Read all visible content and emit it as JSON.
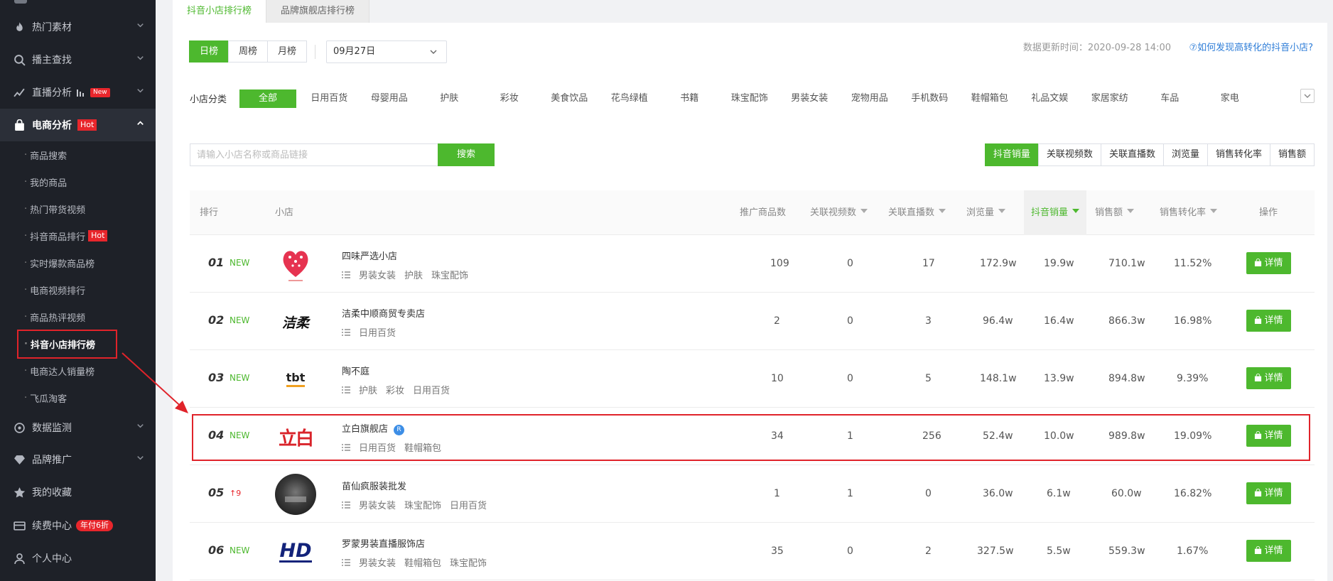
{
  "sidebar": {
    "items": [
      {
        "label": "热门素材",
        "icon": "fire-icon"
      },
      {
        "label": "播主查找",
        "icon": "search-icon"
      },
      {
        "label": "直播分析",
        "icon": "live-analysis-icon",
        "badge": "New"
      },
      {
        "label": "电商分析",
        "icon": "bag-icon",
        "badge": "Hot",
        "expanded": true
      },
      {
        "label": "数据监测",
        "icon": "monitor-icon"
      },
      {
        "label": "品牌推广",
        "icon": "diamond-icon"
      },
      {
        "label": "我的收藏",
        "icon": "star-icon"
      },
      {
        "label": "续费中心",
        "icon": "card-icon",
        "badge": "年付6折"
      },
      {
        "label": "个人中心",
        "icon": "user-icon"
      }
    ],
    "subitems": [
      {
        "label": "商品搜索"
      },
      {
        "label": "我的商品"
      },
      {
        "label": "热门带货视频"
      },
      {
        "label": "抖音商品排行",
        "badge": "Hot"
      },
      {
        "label": "实时爆款商品榜"
      },
      {
        "label": "电商视频排行"
      },
      {
        "label": "商品热评视频"
      },
      {
        "label": "抖音小店排行榜",
        "active": true
      },
      {
        "label": "电商达人销量榜"
      },
      {
        "label": "飞瓜淘客"
      }
    ]
  },
  "tabs": [
    {
      "label": "抖音小店排行榜",
      "active": true
    },
    {
      "label": "品牌旗舰店排行榜",
      "active": false
    }
  ],
  "period": {
    "options": [
      "日榜",
      "周榜",
      "月榜"
    ],
    "selected": "日榜",
    "date": "09月27日"
  },
  "update_text": "数据更新时间：2020-09-28 14:00",
  "help_link": "⑦如何发现高转化的抖音小店?",
  "category": {
    "label": "小店分类",
    "options": [
      "全部",
      "日用百货",
      "母婴用品",
      "护肤",
      "彩妆",
      "美食饮品",
      "花鸟绿植",
      "书籍",
      "珠宝配饰",
      "男装女装",
      "宠物用品",
      "手机数码",
      "鞋帽箱包",
      "礼品文娱",
      "家居家纺",
      "车品",
      "家电"
    ],
    "selected": "全部"
  },
  "search": {
    "placeholder": "请输入小店名称或商品链接",
    "button": "搜索"
  },
  "metrics": {
    "options": [
      "抖音销量",
      "关联视频数",
      "关联直播数",
      "浏览量",
      "销售转化率",
      "销售额"
    ],
    "selected": "抖音销量"
  },
  "table": {
    "headers": {
      "rank": "排行",
      "shop": "小店",
      "products": "推广商品数",
      "videos": "关联视频数",
      "lives": "关联直播数",
      "views": "浏览量",
      "sales": "抖音销量",
      "revenue": "销售额",
      "conversion": "销售转化率",
      "action": "操作"
    },
    "sorted_by": "抖音销量",
    "detail_label": "详情",
    "rows": [
      {
        "rank": "01",
        "change": "NEW",
        "name": "四味严选小店",
        "logo": "heart-logo",
        "cats": [
          "男装女装",
          "护肤",
          "珠宝配饰"
        ],
        "products": "109",
        "videos": "0",
        "lives": "17",
        "views": "172.9w",
        "sales": "19.9w",
        "revenue": "710.1w",
        "conversion": "11.52%"
      },
      {
        "rank": "02",
        "change": "NEW",
        "name": "洁柔中顺商贸专卖店",
        "logo": "jierou-logo",
        "logo_text": "洁柔",
        "cats": [
          "日用百货"
        ],
        "products": "2",
        "videos": "0",
        "lives": "3",
        "views": "96.4w",
        "sales": "16.4w",
        "revenue": "866.3w",
        "conversion": "16.98%"
      },
      {
        "rank": "03",
        "change": "NEW",
        "name": "陶不庭",
        "logo": "tbt-logo",
        "logo_text": "tbt",
        "cats": [
          "护肤",
          "彩妆",
          "日用百货"
        ],
        "products": "10",
        "videos": "0",
        "lives": "5",
        "views": "148.1w",
        "sales": "13.9w",
        "revenue": "894.8w",
        "conversion": "9.39%"
      },
      {
        "rank": "04",
        "change": "NEW",
        "name": "立白旗舰店",
        "badge": "R",
        "logo": "libai-logo",
        "logo_text": "立白",
        "cats": [
          "日用百货",
          "鞋帽箱包"
        ],
        "products": "34",
        "videos": "1",
        "lives": "256",
        "views": "52.4w",
        "sales": "10.0w",
        "revenue": "989.8w",
        "conversion": "19.09%"
      },
      {
        "rank": "05",
        "change": "↑9",
        "name": "苗仙疯服装批发",
        "logo": "photo-logo",
        "cats": [
          "男装女装",
          "珠宝配饰",
          "日用百货"
        ],
        "products": "1",
        "videos": "1",
        "lives": "0",
        "views": "36.0w",
        "sales": "6.1w",
        "revenue": "60.0w",
        "conversion": "16.82%"
      },
      {
        "rank": "06",
        "change": "NEW",
        "name": "罗蒙男装直播服饰店",
        "logo": "hd-logo",
        "logo_text": "HD",
        "cats": [
          "男装女装",
          "鞋帽箱包",
          "珠宝配饰"
        ],
        "products": "35",
        "videos": "0",
        "lives": "2",
        "views": "327.5w",
        "sales": "5.5w",
        "revenue": "559.3w",
        "conversion": "1.67%"
      }
    ]
  },
  "colors": {
    "accent": "#4db82e",
    "sidebar_bg": "#1e2128",
    "highlight": "#e0232a",
    "link": "#2f7ed8"
  }
}
